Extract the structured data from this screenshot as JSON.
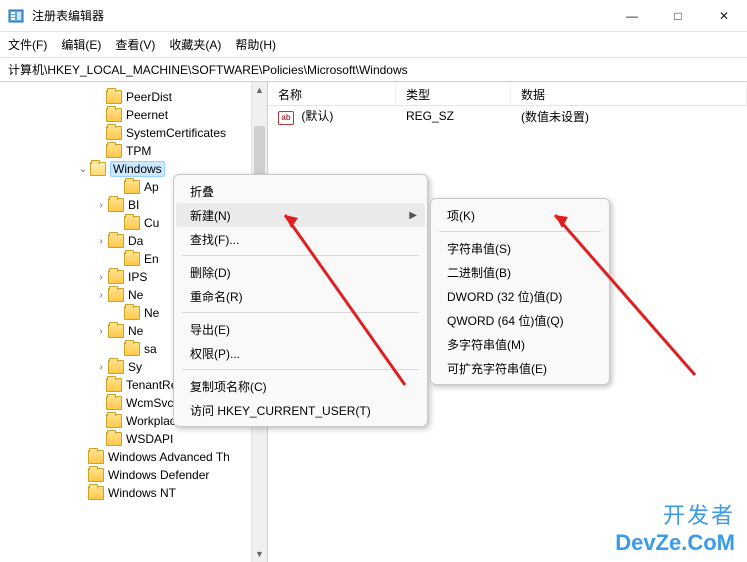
{
  "window": {
    "title": "注册表编辑器",
    "min": "—",
    "max": "□",
    "close": "✕"
  },
  "menubar": {
    "file": "文件(F)",
    "edit": "编辑(E)",
    "view": "查看(V)",
    "favorites": "收藏夹(A)",
    "help": "帮助(H)"
  },
  "path": "计算机\\HKEY_LOCAL_MACHINE\\SOFTWARE\\Policies\\Microsoft\\Windows",
  "tree": {
    "items": [
      {
        "indent": 92,
        "toggle": "",
        "open": false,
        "label": "PeerDist"
      },
      {
        "indent": 92,
        "toggle": "",
        "open": false,
        "label": "Peernet"
      },
      {
        "indent": 92,
        "toggle": "",
        "open": false,
        "label": "SystemCertificates"
      },
      {
        "indent": 92,
        "toggle": "",
        "open": false,
        "label": "TPM"
      },
      {
        "indent": 76,
        "toggle": "v",
        "open": true,
        "label": "Windows",
        "selected": true
      },
      {
        "indent": 110,
        "toggle": "",
        "open": false,
        "label": "Ap"
      },
      {
        "indent": 94,
        "toggle": ">",
        "open": false,
        "label": "BI"
      },
      {
        "indent": 110,
        "toggle": "",
        "open": false,
        "label": "Cu"
      },
      {
        "indent": 94,
        "toggle": ">",
        "open": false,
        "label": "Da"
      },
      {
        "indent": 110,
        "toggle": "",
        "open": false,
        "label": "En"
      },
      {
        "indent": 94,
        "toggle": ">",
        "open": false,
        "label": "IPS"
      },
      {
        "indent": 94,
        "toggle": ">",
        "open": false,
        "label": "Ne"
      },
      {
        "indent": 110,
        "toggle": "",
        "open": false,
        "label": "Ne"
      },
      {
        "indent": 94,
        "toggle": ">",
        "open": false,
        "label": "Ne"
      },
      {
        "indent": 110,
        "toggle": "",
        "open": false,
        "label": "sa"
      },
      {
        "indent": 94,
        "toggle": ">",
        "open": false,
        "label": "Sy"
      },
      {
        "indent": 92,
        "toggle": "",
        "open": false,
        "label": "TenantRestrictions"
      },
      {
        "indent": 92,
        "toggle": "",
        "open": false,
        "label": "WcmSvc"
      },
      {
        "indent": 92,
        "toggle": "",
        "open": false,
        "label": "WorkplaceJoin"
      },
      {
        "indent": 92,
        "toggle": "",
        "open": false,
        "label": "WSDAPI"
      },
      {
        "indent": 74,
        "toggle": "",
        "open": false,
        "label": "Windows Advanced Th"
      },
      {
        "indent": 74,
        "toggle": "",
        "open": false,
        "label": "Windows Defender"
      },
      {
        "indent": 74,
        "toggle": "",
        "open": false,
        "label": "Windows NT"
      }
    ]
  },
  "list": {
    "headers": {
      "name": "名称",
      "type": "类型",
      "data": "数据"
    },
    "rows": [
      {
        "icon": "ab",
        "name": "(默认)",
        "type": "REG_SZ",
        "data": "(数值未设置)"
      }
    ]
  },
  "context_menu_1": {
    "collapse": "折叠",
    "new": "新建(N)",
    "find": "查找(F)...",
    "delete": "删除(D)",
    "rename": "重命名(R)",
    "export": "导出(E)",
    "permissions": "权限(P)...",
    "copy_key_name": "复制项名称(C)",
    "goto_hkcu": "访问 HKEY_CURRENT_USER(T)"
  },
  "context_menu_2": {
    "key": "项(K)",
    "string": "字符串值(S)",
    "binary": "二进制值(B)",
    "dword": "DWORD (32 位)值(D)",
    "qword": "QWORD (64 位)值(Q)",
    "multi_string": "多字符串值(M)",
    "expand_string": "可扩充字符串值(E)"
  },
  "watermark": {
    "l1": "开发者",
    "l2": "DevZe.CoM"
  }
}
